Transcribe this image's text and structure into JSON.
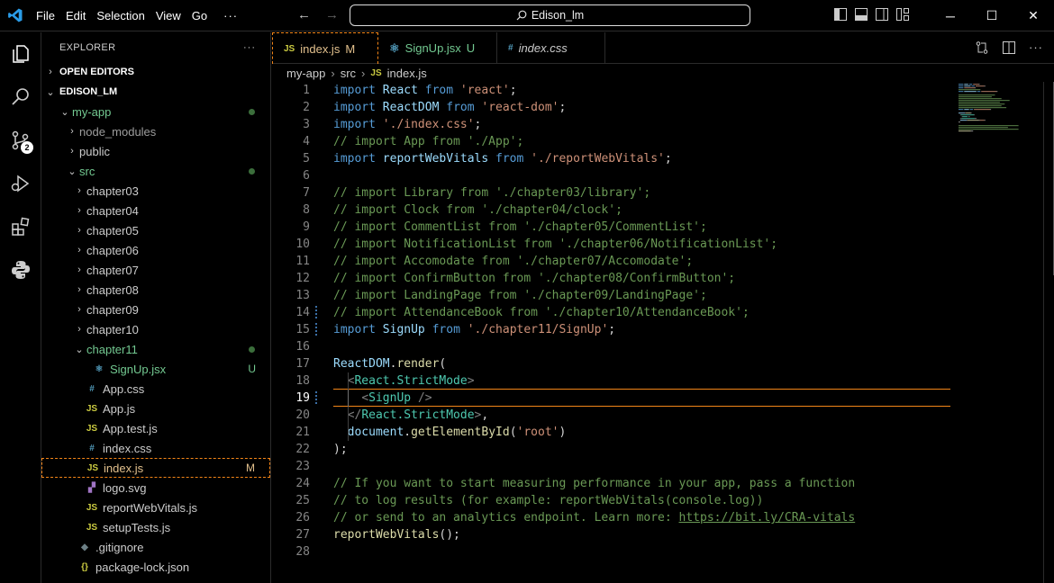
{
  "titlebar": {
    "menu": [
      "File",
      "Edit",
      "Selection",
      "View",
      "Go"
    ],
    "more": "···",
    "search": "Edison_lm",
    "controls": [
      "─",
      "☐",
      "✕"
    ]
  },
  "activity": {
    "icons": [
      "explorer-icon",
      "search-icon",
      "source-control-icon",
      "run-debug-icon",
      "extensions-icon",
      "python-icon"
    ],
    "scm_badge": "2"
  },
  "sidebar": {
    "title": "EXPLORER",
    "more": "···",
    "open_editors": "OPEN EDITORS",
    "root": "EDISON_LM",
    "tree": [
      {
        "label": "my-app",
        "indent": 1,
        "chev": "⌄",
        "color": "green",
        "dot": true
      },
      {
        "label": "node_modules",
        "indent": 2,
        "chev": "›",
        "color": "dim"
      },
      {
        "label": "public",
        "indent": 2,
        "chev": "›"
      },
      {
        "label": "src",
        "indent": 2,
        "chev": "⌄",
        "color": "green",
        "dot": true
      },
      {
        "label": "chapter03",
        "indent": 3,
        "chev": "›"
      },
      {
        "label": "chapter04",
        "indent": 3,
        "chev": "›"
      },
      {
        "label": "chapter05",
        "indent": 3,
        "chev": "›"
      },
      {
        "label": "chapter06",
        "indent": 3,
        "chev": "›"
      },
      {
        "label": "chapter07",
        "indent": 3,
        "chev": "›"
      },
      {
        "label": "chapter08",
        "indent": 3,
        "chev": "›"
      },
      {
        "label": "chapter09",
        "indent": 3,
        "chev": "›"
      },
      {
        "label": "chapter10",
        "indent": 3,
        "chev": "›"
      },
      {
        "label": "chapter11",
        "indent": 3,
        "chev": "⌄",
        "color": "green",
        "dot": true
      },
      {
        "label": "SignUp.jsx",
        "indent": 4,
        "icon": "react",
        "color": "green",
        "badge": "U"
      },
      {
        "label": "App.css",
        "indent": 3,
        "icon": "css"
      },
      {
        "label": "App.js",
        "indent": 3,
        "icon": "js"
      },
      {
        "label": "App.test.js",
        "indent": 3,
        "icon": "js"
      },
      {
        "label": "index.css",
        "indent": 3,
        "icon": "css"
      },
      {
        "label": "index.js",
        "indent": 3,
        "icon": "js",
        "color": "mod",
        "badge": "M",
        "selected": true
      },
      {
        "label": "logo.svg",
        "indent": 3,
        "icon": "svg"
      },
      {
        "label": "reportWebVitals.js",
        "indent": 3,
        "icon": "js"
      },
      {
        "label": "setupTests.js",
        "indent": 3,
        "icon": "js"
      },
      {
        "label": ".gitignore",
        "indent": 2,
        "icon": "git"
      },
      {
        "label": "package-lock.json",
        "indent": 2,
        "icon": "json"
      }
    ]
  },
  "tabs": [
    {
      "icon": "JS",
      "label": "index.js",
      "badge": "M",
      "active": true
    },
    {
      "icon": "react",
      "label": "SignUp.jsx",
      "badge": "U"
    },
    {
      "icon": "#",
      "label": "index.css"
    }
  ],
  "breadcrumb": [
    "my-app",
    "src",
    "index.js"
  ],
  "code": [
    [
      [
        "k",
        "import"
      ],
      [
        "p",
        " "
      ],
      [
        "v",
        "React"
      ],
      [
        "p",
        " "
      ],
      [
        "k",
        "from"
      ],
      [
        "p",
        " "
      ],
      [
        "s",
        "'react'"
      ],
      [
        "p",
        ";"
      ]
    ],
    [
      [
        "k",
        "import"
      ],
      [
        "p",
        " "
      ],
      [
        "v",
        "ReactDOM"
      ],
      [
        "p",
        " "
      ],
      [
        "k",
        "from"
      ],
      [
        "p",
        " "
      ],
      [
        "s",
        "'react-dom'"
      ],
      [
        "p",
        ";"
      ]
    ],
    [
      [
        "k",
        "import"
      ],
      [
        "p",
        " "
      ],
      [
        "s",
        "'./index.css'"
      ],
      [
        "p",
        ";"
      ]
    ],
    [
      [
        "c",
        "// import App from './App';"
      ]
    ],
    [
      [
        "k",
        "import"
      ],
      [
        "p",
        " "
      ],
      [
        "v",
        "reportWebVitals"
      ],
      [
        "p",
        " "
      ],
      [
        "k",
        "from"
      ],
      [
        "p",
        " "
      ],
      [
        "s",
        "'./reportWebVitals'"
      ],
      [
        "p",
        ";"
      ]
    ],
    [],
    [
      [
        "c",
        "// import Library from './chapter03/library';"
      ]
    ],
    [
      [
        "c",
        "// import Clock from './chapter04/clock';"
      ]
    ],
    [
      [
        "c",
        "// import CommentList from './chapter05/CommentList';"
      ]
    ],
    [
      [
        "c",
        "// import NotificationList from './chapter06/NotificationList';"
      ]
    ],
    [
      [
        "c",
        "// import Accomodate from './chapter07/Accomodate';"
      ]
    ],
    [
      [
        "c",
        "// import ConfirmButton from './chapter08/ConfirmButton';"
      ]
    ],
    [
      [
        "c",
        "// import LandingPage from './chapter09/LandingPage';"
      ]
    ],
    [
      [
        "c",
        "// import AttendanceBook from './chapter10/AttendanceBook';"
      ]
    ],
    [
      [
        "k",
        "import"
      ],
      [
        "p",
        " "
      ],
      [
        "v",
        "SignUp"
      ],
      [
        "p",
        " "
      ],
      [
        "k",
        "from"
      ],
      [
        "p",
        " "
      ],
      [
        "s",
        "'./chapter11/SignUp'"
      ],
      [
        "p",
        ";"
      ]
    ],
    [],
    [
      [
        "v",
        "ReactDOM"
      ],
      [
        "p",
        "."
      ],
      [
        "f",
        "render"
      ],
      [
        "p",
        "("
      ]
    ],
    [
      [
        "p",
        "  "
      ],
      [
        "tg",
        "<"
      ],
      [
        "t",
        "React.StrictMode"
      ],
      [
        "tg",
        ">"
      ]
    ],
    [
      [
        "p",
        "    "
      ],
      [
        "tg",
        "<"
      ],
      [
        "t",
        "SignUp"
      ],
      [
        "p",
        " "
      ],
      [
        "tg",
        "/>"
      ]
    ],
    [
      [
        "p",
        "  "
      ],
      [
        "tg",
        "</"
      ],
      [
        "t",
        "React.StrictMode"
      ],
      [
        "tg",
        ">"
      ],
      [
        "p",
        ","
      ]
    ],
    [
      [
        "p",
        "  "
      ],
      [
        "v",
        "document"
      ],
      [
        "p",
        "."
      ],
      [
        "f",
        "getElementById"
      ],
      [
        "p",
        "("
      ],
      [
        "s",
        "'root'"
      ],
      [
        "p",
        ")"
      ]
    ],
    [
      [
        "p",
        ");"
      ]
    ],
    [],
    [
      [
        "c",
        "// If you want to start measuring performance in your app, pass a function"
      ]
    ],
    [
      [
        "c",
        "// to log results (for example: reportWebVitals(console.log))"
      ]
    ],
    [
      [
        "c",
        "// or send to an analytics endpoint. Learn more: "
      ],
      [
        "cl",
        "https://bit.ly/CRA-vitals"
      ]
    ],
    [
      [
        "f",
        "reportWebVitals"
      ],
      [
        "p",
        "();"
      ]
    ],
    []
  ],
  "current_line": 19,
  "modified_lines": [
    14,
    15,
    19
  ]
}
